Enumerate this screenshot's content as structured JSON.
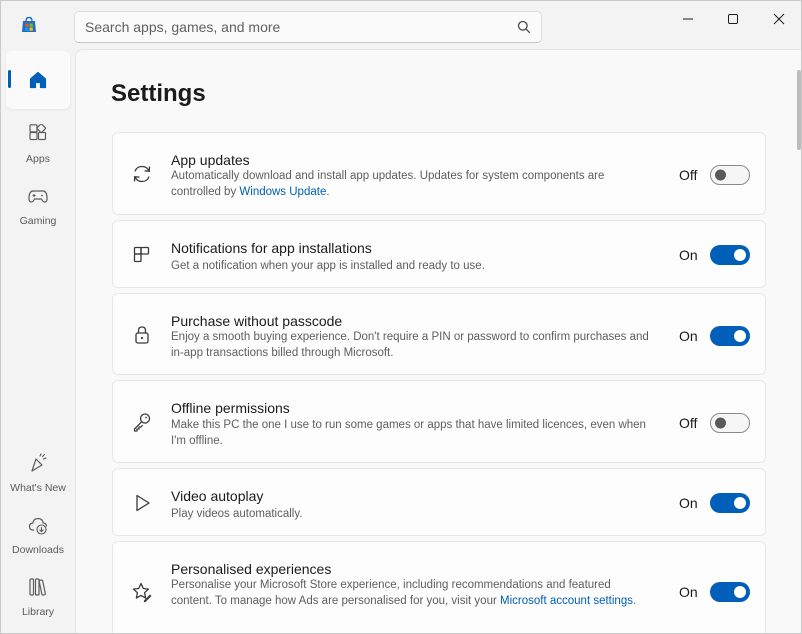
{
  "search": {
    "placeholder": "Search apps, games, and more"
  },
  "nav": {
    "items": [
      {
        "label": "",
        "icon": "home-icon",
        "active": true
      },
      {
        "label": "Apps",
        "icon": "apps-icon"
      },
      {
        "label": "Gaming",
        "icon": "gamepad-icon"
      },
      {
        "label": "What's New",
        "icon": "sparkle-icon"
      },
      {
        "label": "Downloads",
        "icon": "download-icon"
      },
      {
        "label": "Library",
        "icon": "library-icon"
      }
    ]
  },
  "page": {
    "title": "Settings"
  },
  "settings": [
    {
      "title": "App updates",
      "desc_1": "Automatically download and install app updates. Updates for system components are controlled by ",
      "link": "Windows Update",
      "desc_2": ".",
      "state": "Off",
      "enabled": false,
      "icon": "refresh-icon"
    },
    {
      "title": "Notifications for app installations",
      "desc_1": "Get a notification when your app is installed and ready to use.",
      "link": "",
      "desc_2": "",
      "state": "On",
      "enabled": true,
      "icon": "notification-icon"
    },
    {
      "title": "Purchase without passcode",
      "desc_1": "Enjoy a smooth buying experience. Don't require a PIN or password to confirm purchases and in-app transactions billed through Microsoft.",
      "link": "",
      "desc_2": "",
      "state": "On",
      "enabled": true,
      "icon": "lock-icon"
    },
    {
      "title": "Offline permissions",
      "desc_1": "Make this PC the one I use to run some games or apps that have limited licences, even when I'm offline.",
      "link": "",
      "desc_2": "",
      "state": "Off",
      "enabled": false,
      "icon": "key-icon"
    },
    {
      "title": "Video autoplay",
      "desc_1": "Play videos automatically.",
      "link": "",
      "desc_2": "",
      "state": "On",
      "enabled": true,
      "icon": "play-icon"
    },
    {
      "title": "Personalised experiences",
      "desc_1": "Personalise your Microsoft Store experience, including recommendations and featured content. To manage how Ads are personalised for you, visit your ",
      "link": "Microsoft account settings",
      "desc_2": ".",
      "state": "On",
      "enabled": true,
      "icon": "star-edit-icon"
    }
  ],
  "colors": {
    "accent": "#005fb8",
    "link": "#005fb8"
  }
}
